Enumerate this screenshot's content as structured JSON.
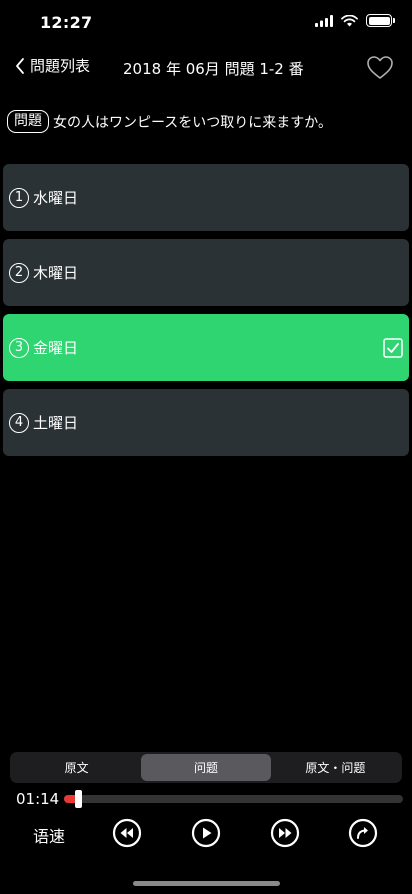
{
  "status": {
    "time": "12:27"
  },
  "nav": {
    "back_label": "問題列表",
    "title": "2018 年 06月 問題 1-2 番"
  },
  "question": {
    "tag": "問題",
    "text": "女の人はワンピースをいつ取りに来ますか。"
  },
  "options": [
    {
      "number": "1",
      "label": "水曜日",
      "selected": false
    },
    {
      "number": "2",
      "label": "木曜日",
      "selected": false
    },
    {
      "number": "3",
      "label": "金曜日",
      "selected": true
    },
    {
      "number": "4",
      "label": "土曜日",
      "selected": false
    }
  ],
  "tabs": [
    {
      "label": "原文",
      "active": false
    },
    {
      "label": "问题",
      "active": true
    },
    {
      "label": "原文・问题",
      "active": false
    }
  ],
  "player": {
    "current_time": "01:14",
    "progress": 0.04,
    "speed_label": "语速"
  },
  "colors": {
    "selected": "#2fd571",
    "option_bg": "#2b3236",
    "progress": "#e53935"
  },
  "icons": [
    "chevron-left-icon",
    "heart-icon",
    "check-icon",
    "rewind-icon",
    "play-icon",
    "fast-forward-icon",
    "share-icon"
  ]
}
